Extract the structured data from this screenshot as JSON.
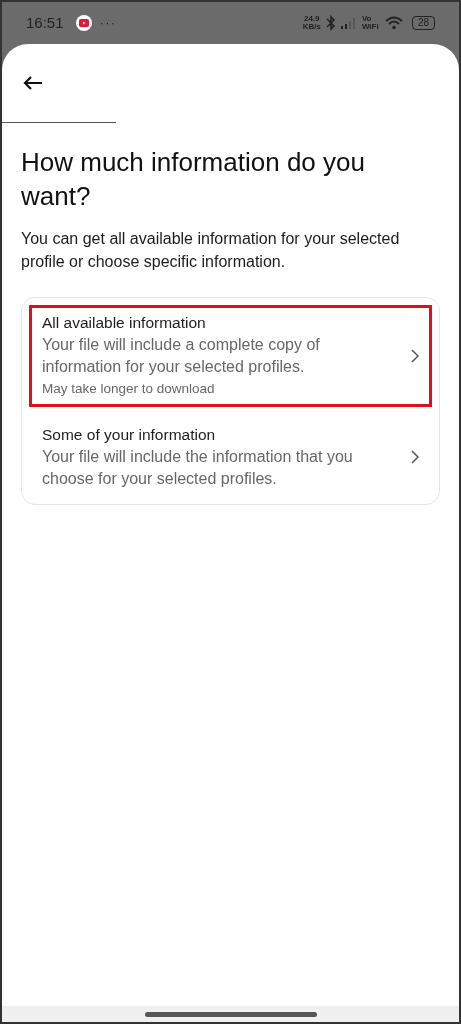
{
  "status_bar": {
    "time": "16:51",
    "more": "···",
    "net_speed": "24.9",
    "net_unit": "KB/s",
    "network": "Vo WiFi",
    "battery": "28"
  },
  "title": "How much information do you want?",
  "description": "You can get all available information for your selected profile or choose specific information.",
  "options": [
    {
      "title": "All available information",
      "description": "Your file will include a complete copy of information for your selected profiles.",
      "note": "May take longer to download",
      "highlighted": true
    },
    {
      "title": "Some of your information",
      "description": "Your file will include the information that you choose for your selected profiles.",
      "highlighted": false
    }
  ]
}
